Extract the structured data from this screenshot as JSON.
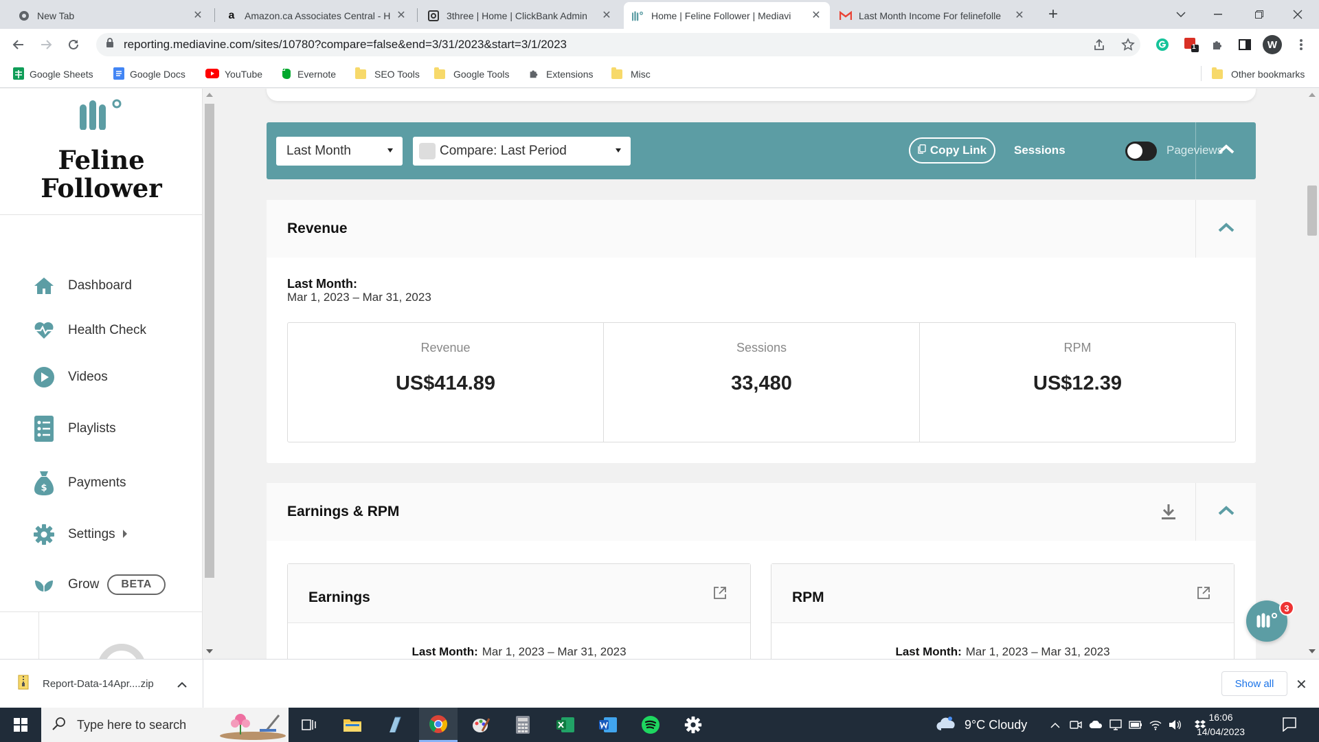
{
  "browser": {
    "tabs": [
      {
        "title": "New Tab",
        "icon": "chrome-icon",
        "active": false
      },
      {
        "title": "Amazon.ca Associates Central - H",
        "icon": "amazon-icon",
        "active": false
      },
      {
        "title": "3three | Home | ClickBank Admin",
        "icon": "clickbank-icon",
        "active": false
      },
      {
        "title": "Home | Feline Follower | Mediavi",
        "icon": "mediavine-icon",
        "active": true
      },
      {
        "title": "Last Month Income For felinefolle",
        "icon": "gmail-icon",
        "active": false
      }
    ],
    "url": "reporting.mediavine.com/sites/10780?compare=false&end=3/31/2023&start=3/1/2023",
    "profile_initial": "W",
    "extension_badge": "1",
    "bookmarks": [
      {
        "label": "Google Sheets",
        "icon": "google-sheets-icon"
      },
      {
        "label": "Google Docs",
        "icon": "google-docs-icon"
      },
      {
        "label": "YouTube",
        "icon": "youtube-icon"
      },
      {
        "label": "Evernote",
        "icon": "evernote-icon"
      },
      {
        "label": "SEO Tools",
        "icon": "folder-icon"
      },
      {
        "label": "Google Tools",
        "icon": "folder-icon"
      },
      {
        "label": "Extensions",
        "icon": "puzzle-icon"
      },
      {
        "label": "Misc",
        "icon": "folder-icon"
      }
    ],
    "other_bookmarks": "Other bookmarks"
  },
  "sidebar": {
    "brand": "Feline Follower",
    "items": [
      {
        "label": "Dashboard",
        "icon": "home-icon"
      },
      {
        "label": "Health Check",
        "icon": "heartbeat-icon"
      },
      {
        "label": "Videos",
        "icon": "play-circle-icon"
      },
      {
        "label": "Playlists",
        "icon": "list-icon"
      },
      {
        "label": "Payments",
        "icon": "money-bag-icon"
      },
      {
        "label": "Settings",
        "icon": "gear-icon"
      },
      {
        "label": "Grow",
        "icon": "leaf-icon"
      }
    ],
    "beta": "BETA"
  },
  "filters": {
    "period": "Last Month",
    "compare": "Compare: Last Period",
    "copy_link": "Copy Link",
    "sessions": "Sessions",
    "pageviews": "Pageviews",
    "toggle_mode": "Sessions"
  },
  "revenue_card": {
    "title": "Revenue",
    "period_label": "Last Month:",
    "period_range": "Mar 1, 2023 – Mar 31, 2023",
    "metrics": [
      {
        "label": "Revenue",
        "value": "US$414.89"
      },
      {
        "label": "Sessions",
        "value": "33,480"
      },
      {
        "label": "RPM",
        "value": "US$12.39"
      }
    ]
  },
  "earnings_card": {
    "title": "Earnings & RPM",
    "charts": [
      {
        "title": "Earnings",
        "period_label": "Last Month:",
        "period_range": "Mar 1, 2023 – Mar 31, 2023"
      },
      {
        "title": "RPM",
        "period_label": "Last Month:",
        "period_range": "Mar 1, 2023 – Mar 31, 2023"
      }
    ]
  },
  "chat_badge": "3",
  "colors": {
    "accent": "#5c9da4",
    "chrome_bar": "#dee1e6",
    "taskbar": "#202c39"
  },
  "download": {
    "file": "Report-Data-14Apr....zip",
    "show_all": "Show all"
  },
  "taskbar": {
    "search_placeholder": "Type here to search",
    "weather": "9°C  Cloudy",
    "time": "16:06",
    "date": "14/04/2023"
  }
}
